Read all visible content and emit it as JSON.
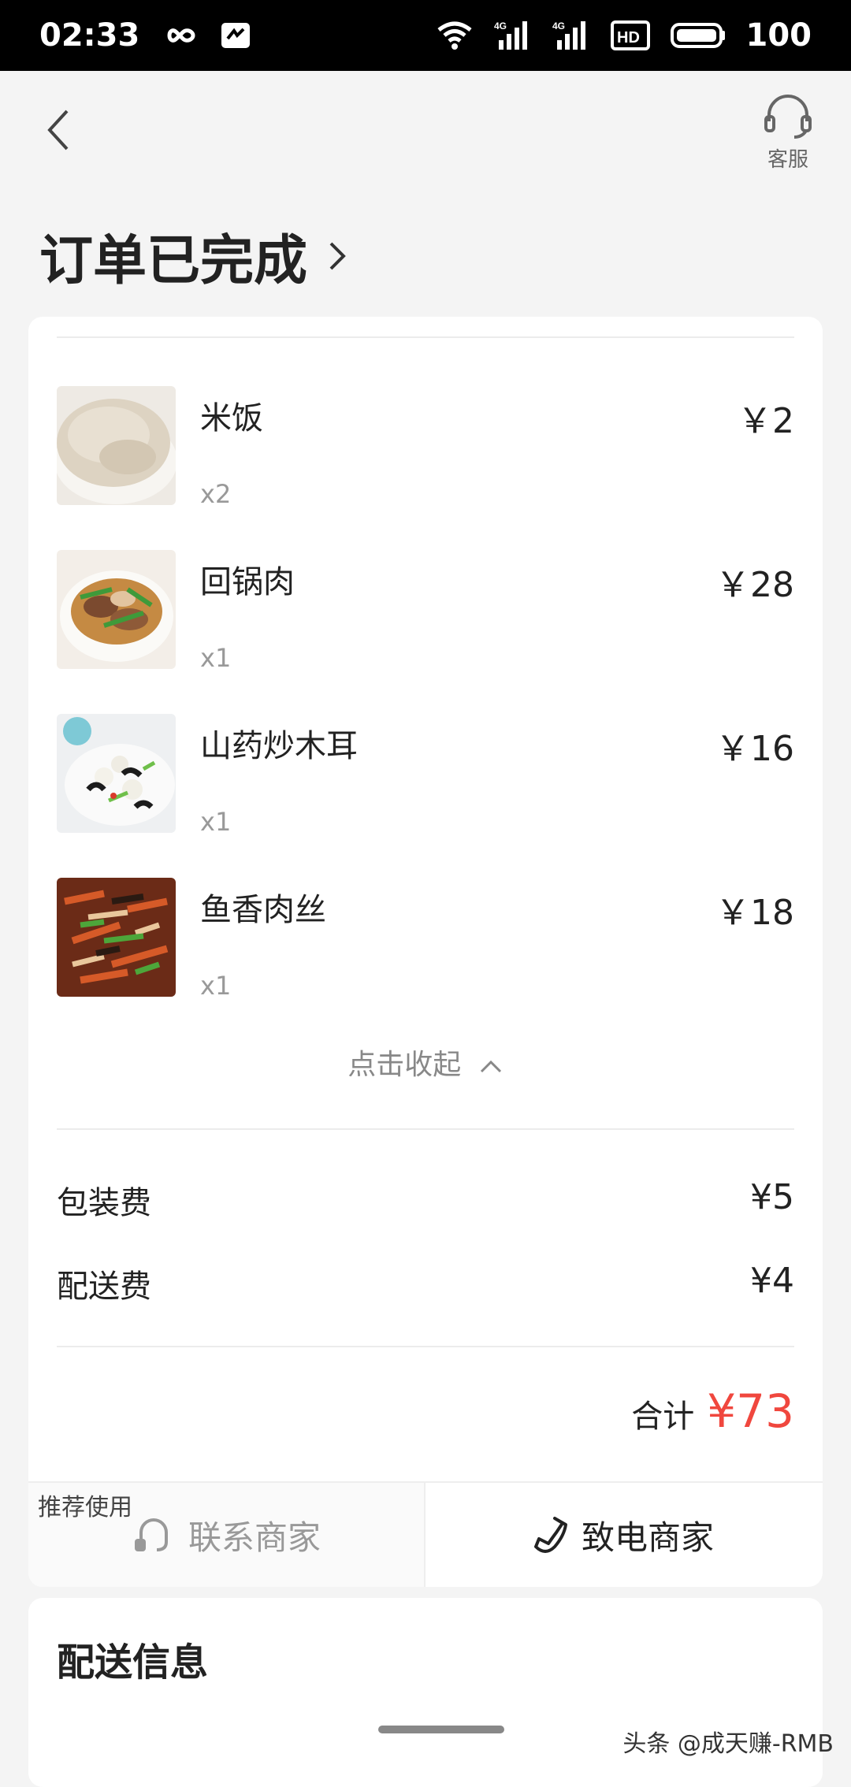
{
  "status_bar": {
    "time": "02:33",
    "battery": "100",
    "net_labels": [
      "4G",
      "4G"
    ],
    "hd_label": "HD"
  },
  "header": {
    "service_label": "客服",
    "order_status": "订单已完成"
  },
  "items": [
    {
      "name": "米饭",
      "qty": "x2",
      "price": "￥2"
    },
    {
      "name": "回锅肉",
      "qty": "x1",
      "price": "￥28"
    },
    {
      "name": "山药炒木耳",
      "qty": "x1",
      "price": "￥16"
    },
    {
      "name": "鱼香肉丝",
      "qty": "x1",
      "price": "￥18"
    }
  ],
  "collapse_label": "点击收起",
  "fees": [
    {
      "label": "包装费",
      "value": "¥5"
    },
    {
      "label": "配送费",
      "value": "¥4"
    }
  ],
  "total": {
    "label": "合计",
    "amount": "¥73"
  },
  "actions": {
    "recommend": "推荐使用",
    "contact_merchant": "联系商家",
    "call_merchant": "致电商家"
  },
  "delivery": {
    "title": "配送信息"
  },
  "watermark": "头条 @成天赚-RMB",
  "colors": {
    "accent": "#f0473e",
    "background": "#f4f4f4"
  }
}
